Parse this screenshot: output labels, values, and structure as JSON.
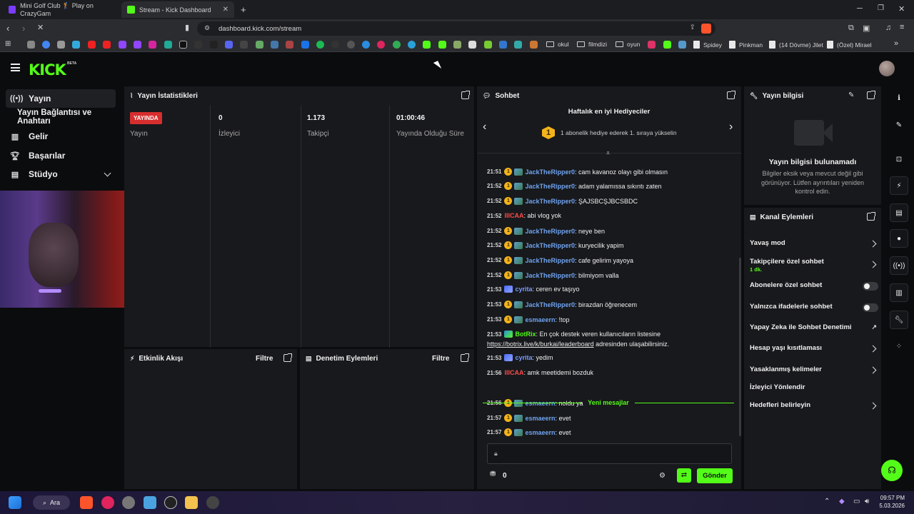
{
  "browser": {
    "tabs": [
      {
        "label": "Mini Golf Club 🏌 Play on CrazyGam"
      },
      {
        "label": "Stream - Kick Dashboard"
      }
    ],
    "url": "dashboard.kick.com/stream",
    "bookmarks": [
      "okul",
      "filmdizi",
      "oyun",
      "Spidey",
      "Pinkman",
      "(14 Dövme) Jilet",
      "(Özel) Mirael"
    ]
  },
  "app": {
    "logo": "KICK",
    "logo_badge": "BETA",
    "sidebar": {
      "items": [
        {
          "label": "Yayın",
          "icon": "broadcast-icon"
        },
        {
          "label": "Yayın Bağlantısı ve Anahtarı"
        },
        {
          "label": "Gelir",
          "icon": "chart-icon"
        },
        {
          "label": "Başarılar",
          "icon": "trophy-icon"
        },
        {
          "label": "Stüdyo",
          "icon": "studio-icon"
        }
      ]
    },
    "stats": {
      "title": "Yayın İstatistikleri",
      "live_badge": "YAYINDA",
      "status_label": "Yayın",
      "viewers_value": "0",
      "viewers_label": "İzleyici",
      "followers_value": "1.173",
      "followers_label": "Takipçi",
      "uptime_value": "01:00:46",
      "uptime_label": "Yayında Olduğu Süre"
    },
    "activity": {
      "title": "Etkinlik Akışı",
      "filter": "Filtre"
    },
    "moderation": {
      "title": "Denetim Eylemleri",
      "filter": "Filtre"
    },
    "chat": {
      "title": "Sohbet",
      "gifters_title": "Haftalık en iyi Hediyeciler",
      "gifters_rank": "1",
      "gifters_text": "1 abonelik hediye ederek 1. sıraya yükselin",
      "messages": [
        {
          "time": "21:51",
          "user": "JackTheRipper0",
          "text": ": cam kavanoz olayı gibi olmasın"
        },
        {
          "time": "21:52",
          "user": "JackTheRipper0",
          "text": ": adam yalamıssa sıkıntı zaten"
        },
        {
          "time": "21:52",
          "user": "JackTheRipper0",
          "text": ": ŞAJSBCŞJBCSBDC"
        },
        {
          "time": "21:52",
          "user": "lllCAA",
          "text": ": abi vlog yok"
        },
        {
          "time": "21:52",
          "user": "JackTheRipper0",
          "text": ": neye ben"
        },
        {
          "time": "21:52",
          "user": "JackTheRipper0",
          "text": ": kuryecilik yapim"
        },
        {
          "time": "21:52",
          "user": "JackTheRipper0",
          "text": ": cafe gelirim yayoya"
        },
        {
          "time": "21:52",
          "user": "JackTheRipper0",
          "text": ": bilmiyom valla"
        },
        {
          "time": "21:53",
          "user": "cyrita",
          "text": ": ceren ev taşıyo"
        },
        {
          "time": "21:53",
          "user": "JackTheRipper0",
          "text": ": birazdan öğrenecem"
        },
        {
          "time": "21:53",
          "user": "esmaeern",
          "text": ": !top"
        },
        {
          "time": "21:53",
          "user": "BotRix",
          "text": ": En çok destek veren kullanıcıların listesine"
        },
        {
          "time": "21:53",
          "user": "cyrita",
          "text": ": yedim"
        },
        {
          "time": "21:56",
          "user": "lllCAA",
          "text": ": amk meetidemi bozduk"
        },
        {
          "time": "21:56",
          "user": "esmaeern",
          "text": ": noldu ya"
        },
        {
          "time": "21:57",
          "user": "esmaeern",
          "text": ": evet"
        },
        {
          "time": "21:57",
          "user": "esmaeern",
          "text": ": evet"
        }
      ],
      "botrix_link": "https://botrix.live/k/burkai/leaderboard",
      "botrix_link_suffix": " adresinden ulaşabilirsiniz.",
      "new_messages": "Yeni mesajlar",
      "points": "0",
      "send": "Gönder"
    },
    "stream_info": {
      "title": "Yayın bilgisi",
      "empty_title": "Yayın bilgisi bulunamadı",
      "empty_text": "Bilgiler eksik veya mevcut değil gibi görünüyor. Lütfen ayrıntıları yeniden kontrol edin."
    },
    "channel_actions": {
      "title": "Kanal Eylemleri",
      "items": [
        {
          "label": "Yavaş mod"
        },
        {
          "label": "Takipçilere özel sohbet",
          "sub": "1 dk."
        },
        {
          "label": "Abonelere özel sohbet"
        },
        {
          "label": "Yalnızca ifadelerle sohbet"
        },
        {
          "label": "Yapay Zeka ile Sohbet Denetimi"
        },
        {
          "label": "Hesap yaşı kısıtlaması"
        },
        {
          "label": "Yasaklanmış kelimeler"
        },
        {
          "label": "İzleyici Yönlendir"
        },
        {
          "label": "Hedefleri belirleyin"
        }
      ]
    }
  },
  "taskbar": {
    "search": "Ara",
    "time": "09:57 PM",
    "date": "5.03.2026"
  }
}
